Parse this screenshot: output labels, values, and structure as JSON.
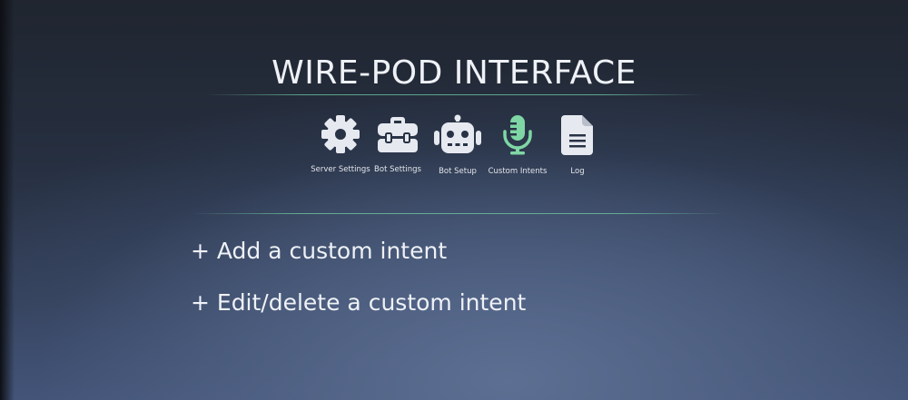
{
  "app": {
    "title": "WIRE-POD INTERFACE"
  },
  "nav": {
    "items": [
      {
        "label": "Server Settings",
        "icon": "gear-icon",
        "active": false
      },
      {
        "label": "Bot Settings",
        "icon": "toolbox-icon",
        "active": false
      },
      {
        "label": "Bot Setup",
        "icon": "robot-icon",
        "active": false
      },
      {
        "label": "Custom Intents",
        "icon": "microphone-icon",
        "active": true
      },
      {
        "label": "Log",
        "icon": "document-icon",
        "active": false
      }
    ]
  },
  "menu": {
    "add_label": "+ Add a custom intent",
    "edit_label": "+ Edit/delete a custom intent"
  },
  "colors": {
    "icon": "#e6e9ef",
    "active_icon": "#7fd6a4",
    "accent_rule": "#6fcda5"
  }
}
